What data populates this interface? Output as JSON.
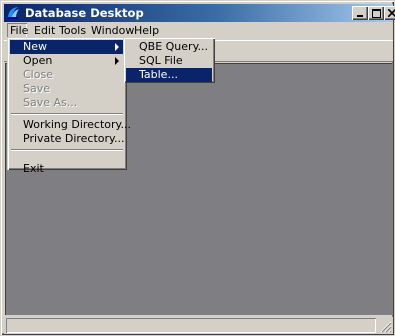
{
  "window": {
    "title": "Database Desktop",
    "icon": "database-desktop-app-icon",
    "controls": [
      "minimize-icon",
      "maximize-icon",
      "close-icon"
    ]
  },
  "menubar": {
    "items": [
      {
        "label": "File"
      },
      {
        "label": "Edit"
      },
      {
        "label": "Tools"
      },
      {
        "label": "Window"
      },
      {
        "label": "Help"
      }
    ]
  },
  "file_menu": {
    "items": [
      {
        "label": "New",
        "submenu": true,
        "state": "highlighted"
      },
      {
        "label": "Open",
        "submenu": true,
        "state": "enabled"
      },
      {
        "label": "Close",
        "state": "disabled"
      },
      {
        "label": "Save",
        "state": "disabled"
      },
      {
        "label": "Save As...",
        "state": "disabled"
      },
      {
        "label": "Working Directory...",
        "state": "enabled"
      },
      {
        "label": "Private Directory...",
        "state": "enabled"
      },
      {
        "label": "Exit",
        "state": "enabled"
      }
    ]
  },
  "new_submenu": {
    "items": [
      {
        "label": "QBE Query..."
      },
      {
        "label": "SQL File"
      },
      {
        "label": "Table..."
      }
    ]
  },
  "colors": {
    "highlight": "#0a246a",
    "face": "#d4d0c8",
    "workspace": "#7f7e82"
  }
}
